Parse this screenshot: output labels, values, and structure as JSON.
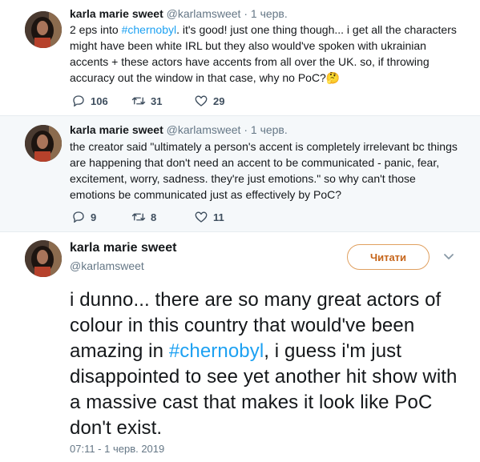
{
  "tweets": [
    {
      "name": "karla marie sweet",
      "handle": "@karlamsweet",
      "separator": "·",
      "date": "1 черв.",
      "text_before": "2 eps into ",
      "hashtag": "#chernobyl",
      "text_after": ". it's good! just one thing though... i get all the characters might have been white IRL but they also would've spoken with ukrainian accents + these actors have accents from all over the UK. so, if throwing accuracy out the window in that case, why no PoC?🤔",
      "replies": "106",
      "retweets": "31",
      "likes": "29"
    },
    {
      "name": "karla marie sweet",
      "handle": "@karlamsweet",
      "separator": "·",
      "date": "1 черв.",
      "text": "the creator said \"ultimately a person's accent is completely irrelevant bc things are happening that don't need an accent to be communicated - panic, fear, excitement, worry, sadness. they're just emotions.\" so why can't those emotions be communicated just as effectively by PoC?",
      "replies": "9",
      "retweets": "8",
      "likes": "11"
    }
  ],
  "main_tweet": {
    "name": "karla marie sweet",
    "handle": "@karlamsweet",
    "follow_label": "Читати",
    "text_before": "i dunno... there are so many great actors of colour in this country that would've been amazing in ",
    "hashtag": "#chernobyl",
    "text_after": ", i guess i'm just disappointed to see yet another hit show with a massive cast that makes it look like PoC don't exist.",
    "timestamp": "07:11 - 1 черв. 2019"
  },
  "icons": {
    "reply": "reply-icon",
    "retweet": "retweet-icon",
    "like": "heart-icon",
    "more": "chevron-down-icon"
  },
  "colors": {
    "link": "#1da1f2",
    "follow_accent": "#c6651a",
    "secondary_text": "#657786"
  }
}
